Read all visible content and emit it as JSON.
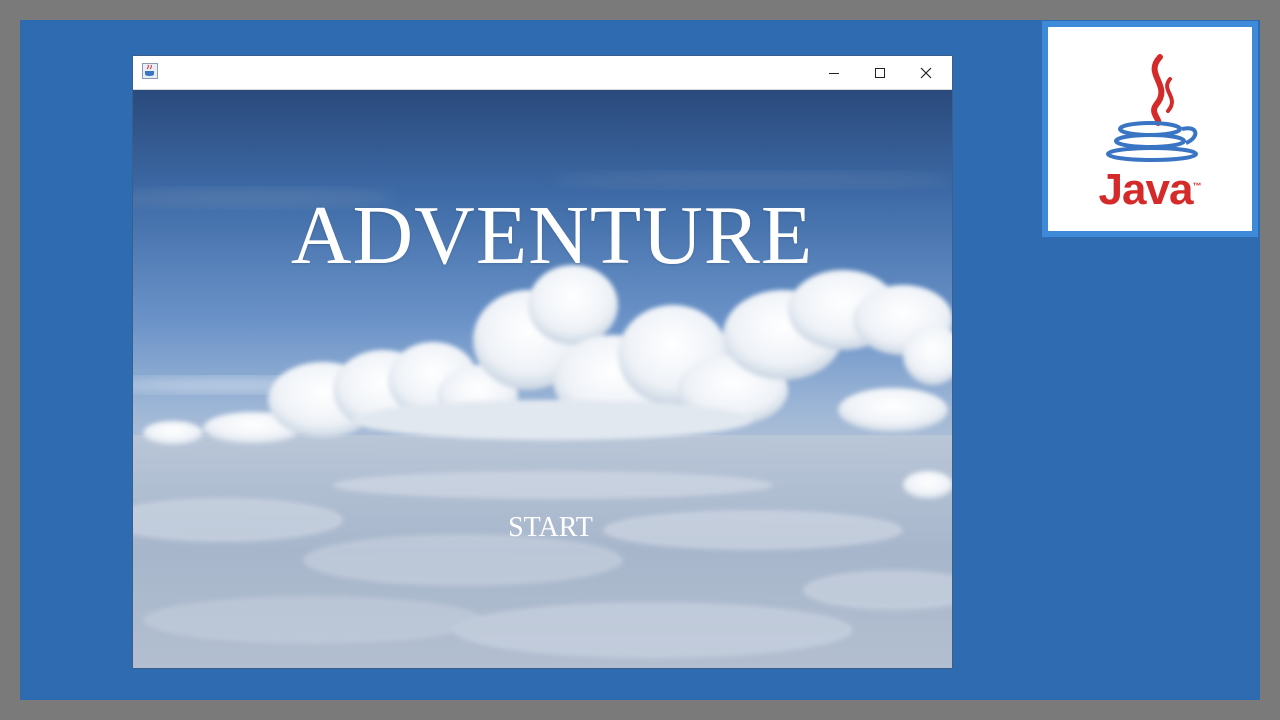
{
  "game": {
    "title": "ADVENTURE",
    "start_label": "START"
  },
  "window": {
    "controls": {
      "minimize_icon": "minimize-icon",
      "maximize_icon": "maximize-icon",
      "close_icon": "close-icon"
    },
    "app_icon": "java-cup-icon"
  },
  "logo": {
    "word": "Java",
    "tm": "™"
  },
  "colors": {
    "frame_background": "#2e6bb0",
    "logo_border": "#3f8ad8",
    "logo_red": "#d42a2a",
    "logo_blue": "#3a75c4",
    "text_white": "#ffffff"
  }
}
